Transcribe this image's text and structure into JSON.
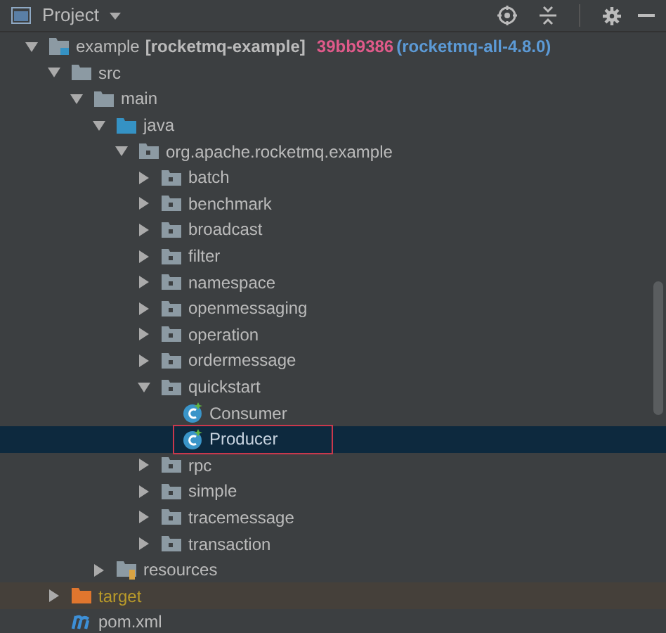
{
  "panel": {
    "title": "Project"
  },
  "tree": [
    {
      "kind": "module",
      "name": "example",
      "module_name": "[rocketmq-example]",
      "revision": "39bb9386",
      "branch": "(rocketmq-all-4.8.0)",
      "expanded": true,
      "selected": false,
      "children": [
        {
          "kind": "folder",
          "name": "src",
          "expanded": true,
          "selected": false,
          "children": [
            {
              "kind": "folder",
              "name": "main",
              "expanded": true,
              "selected": false,
              "children": [
                {
                  "kind": "source-folder",
                  "name": "java",
                  "expanded": true,
                  "selected": false,
                  "children": [
                    {
                      "kind": "package",
                      "name": "org.apache.rocketmq.example",
                      "expanded": true,
                      "selected": false,
                      "children": [
                        {
                          "kind": "package",
                          "name": "batch",
                          "expanded": false,
                          "selected": false
                        },
                        {
                          "kind": "package",
                          "name": "benchmark",
                          "expanded": false,
                          "selected": false
                        },
                        {
                          "kind": "package",
                          "name": "broadcast",
                          "expanded": false,
                          "selected": false
                        },
                        {
                          "kind": "package",
                          "name": "filter",
                          "expanded": false,
                          "selected": false
                        },
                        {
                          "kind": "package",
                          "name": "namespace",
                          "expanded": false,
                          "selected": false
                        },
                        {
                          "kind": "package",
                          "name": "openmessaging",
                          "expanded": false,
                          "selected": false
                        },
                        {
                          "kind": "package",
                          "name": "operation",
                          "expanded": false,
                          "selected": false
                        },
                        {
                          "kind": "package",
                          "name": "ordermessage",
                          "expanded": false,
                          "selected": false
                        },
                        {
                          "kind": "package",
                          "name": "quickstart",
                          "expanded": true,
                          "selected": false,
                          "children": [
                            {
                              "kind": "class",
                              "name": "Consumer",
                              "selected": false
                            },
                            {
                              "kind": "class",
                              "name": "Producer",
                              "selected": true
                            }
                          ]
                        },
                        {
                          "kind": "package",
                          "name": "rpc",
                          "expanded": false,
                          "selected": false
                        },
                        {
                          "kind": "package",
                          "name": "simple",
                          "expanded": false,
                          "selected": false
                        },
                        {
                          "kind": "package",
                          "name": "tracemessage",
                          "expanded": false,
                          "selected": false
                        },
                        {
                          "kind": "package",
                          "name": "transaction",
                          "expanded": false,
                          "selected": false
                        }
                      ]
                    }
                  ]
                },
                {
                  "kind": "resources",
                  "name": "resources",
                  "expanded": false,
                  "selected": false
                }
              ]
            }
          ]
        },
        {
          "kind": "excluded",
          "name": "target",
          "expanded": false,
          "selected": false
        },
        {
          "kind": "maven",
          "name": "pom.xml",
          "selected": false
        }
      ]
    }
  ]
}
